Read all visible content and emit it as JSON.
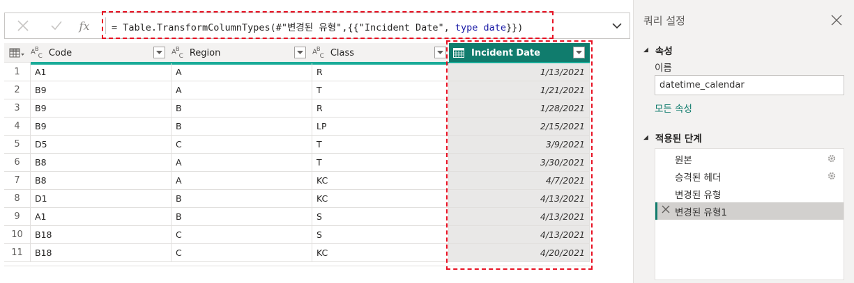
{
  "formula_bar": {
    "prefix": "= Table.TransformColumnTypes(#\"변경된 유형\",{{\"Incident Date\", ",
    "kw": "type",
    "sp": " ",
    "kw2": "date",
    "suffix": "}})",
    "fx_label": "fx"
  },
  "columns": [
    {
      "label": "Code",
      "type_icon": "ABC"
    },
    {
      "label": "Region",
      "type_icon": "ABC"
    },
    {
      "label": "Class",
      "type_icon": "ABC"
    },
    {
      "label": "Incident Date",
      "type_icon": "calendar"
    }
  ],
  "rows": [
    {
      "idx": "1",
      "code": "A1",
      "region": "A",
      "class": "R",
      "date": "1/13/2021"
    },
    {
      "idx": "2",
      "code": "B9",
      "region": "A",
      "class": "T",
      "date": "1/21/2021"
    },
    {
      "idx": "3",
      "code": "B9",
      "region": "B",
      "class": "R",
      "date": "1/28/2021"
    },
    {
      "idx": "4",
      "code": "B9",
      "region": "B",
      "class": "LP",
      "date": "2/15/2021"
    },
    {
      "idx": "5",
      "code": "D5",
      "region": "C",
      "class": "T",
      "date": "3/9/2021"
    },
    {
      "idx": "6",
      "code": "B8",
      "region": "A",
      "class": "T",
      "date": "3/30/2021"
    },
    {
      "idx": "7",
      "code": "B8",
      "region": "A",
      "class": "KC",
      "date": "4/7/2021"
    },
    {
      "idx": "8",
      "code": "D1",
      "region": "B",
      "class": "KC",
      "date": "4/13/2021"
    },
    {
      "idx": "9",
      "code": "A1",
      "region": "B",
      "class": "S",
      "date": "4/13/2021"
    },
    {
      "idx": "10",
      "code": "B18",
      "region": "C",
      "class": "S",
      "date": "4/13/2021"
    },
    {
      "idx": "11",
      "code": "B18",
      "region": "C",
      "class": "KC",
      "date": "4/20/2021"
    }
  ],
  "query_settings": {
    "title": "쿼리 설정",
    "properties_header": "속성",
    "name_label": "이름",
    "name_value": "datetime_calendar",
    "all_properties_link": "모든 속성",
    "applied_steps_header": "적용된 단계",
    "steps": [
      {
        "name": "원본",
        "has_gear": true,
        "active": false
      },
      {
        "name": "승격된 헤더",
        "has_gear": true,
        "active": false
      },
      {
        "name": "변경된 유형",
        "has_gear": false,
        "active": false
      },
      {
        "name": "변경된 유형1",
        "has_gear": false,
        "active": true
      }
    ]
  },
  "colors": {
    "accent_teal": "#107c6d",
    "header_underline": "#1aab98",
    "highlight_red": "#e81123"
  }
}
